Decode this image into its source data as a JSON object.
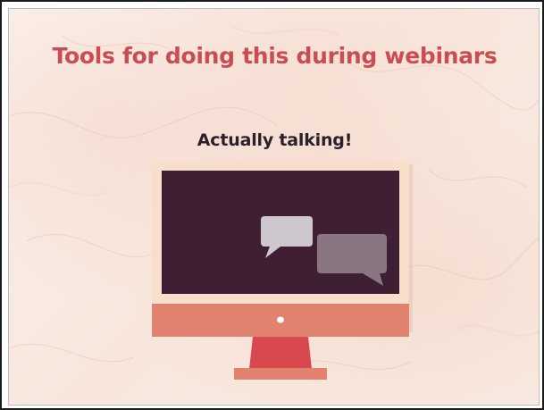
{
  "slide": {
    "title": "Tools for doing this during webinars",
    "subtitle": "Actually talking!"
  },
  "colors": {
    "title": "#c94d55",
    "subtitle": "#2a1f2a",
    "screen": "#3f1f33",
    "bezel": "#f7dfcb",
    "chin": "#e0826d",
    "stand": "#d9484f",
    "bubble_light": "#cec7ce",
    "bubble_dark": "#8a7583"
  },
  "icons": [
    "monitor-icon",
    "speech-bubble-icon",
    "speech-bubble-icon"
  ]
}
